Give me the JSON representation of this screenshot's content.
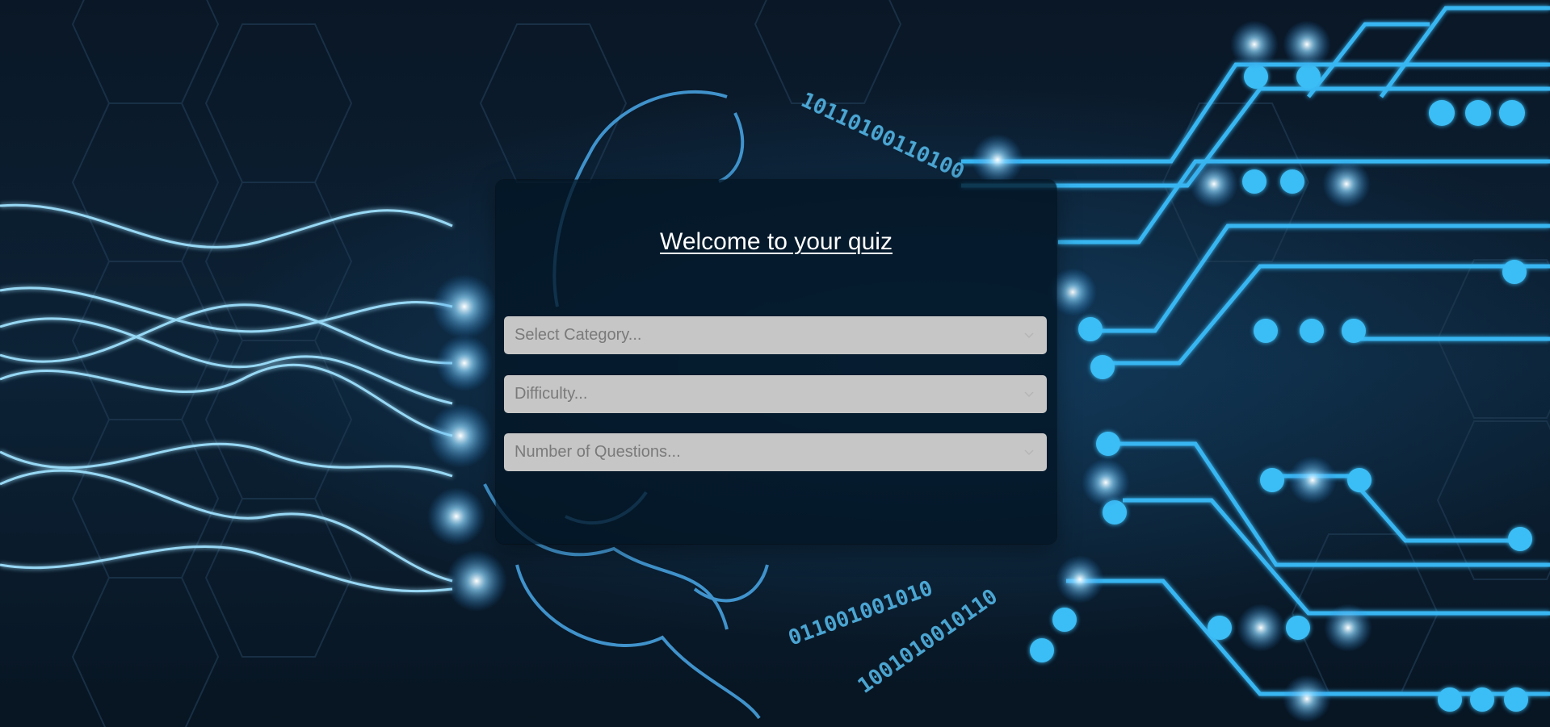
{
  "page": {
    "title": "Welcome to your quiz"
  },
  "form": {
    "category_placeholder": "Select Category...",
    "difficulty_placeholder": "Difficulty...",
    "questions_placeholder": "Number of Questions..."
  },
  "background": {
    "binary_text_1": "10110100110100",
    "binary_text_2": "011001001010",
    "binary_text_3": "1001010010110"
  },
  "colors": {
    "accent_glow": "#4fc3ff",
    "card_bg": "#021424",
    "select_bg": "#c6c6c6",
    "placeholder": "#7a7a7a",
    "title": "#ffffff"
  }
}
